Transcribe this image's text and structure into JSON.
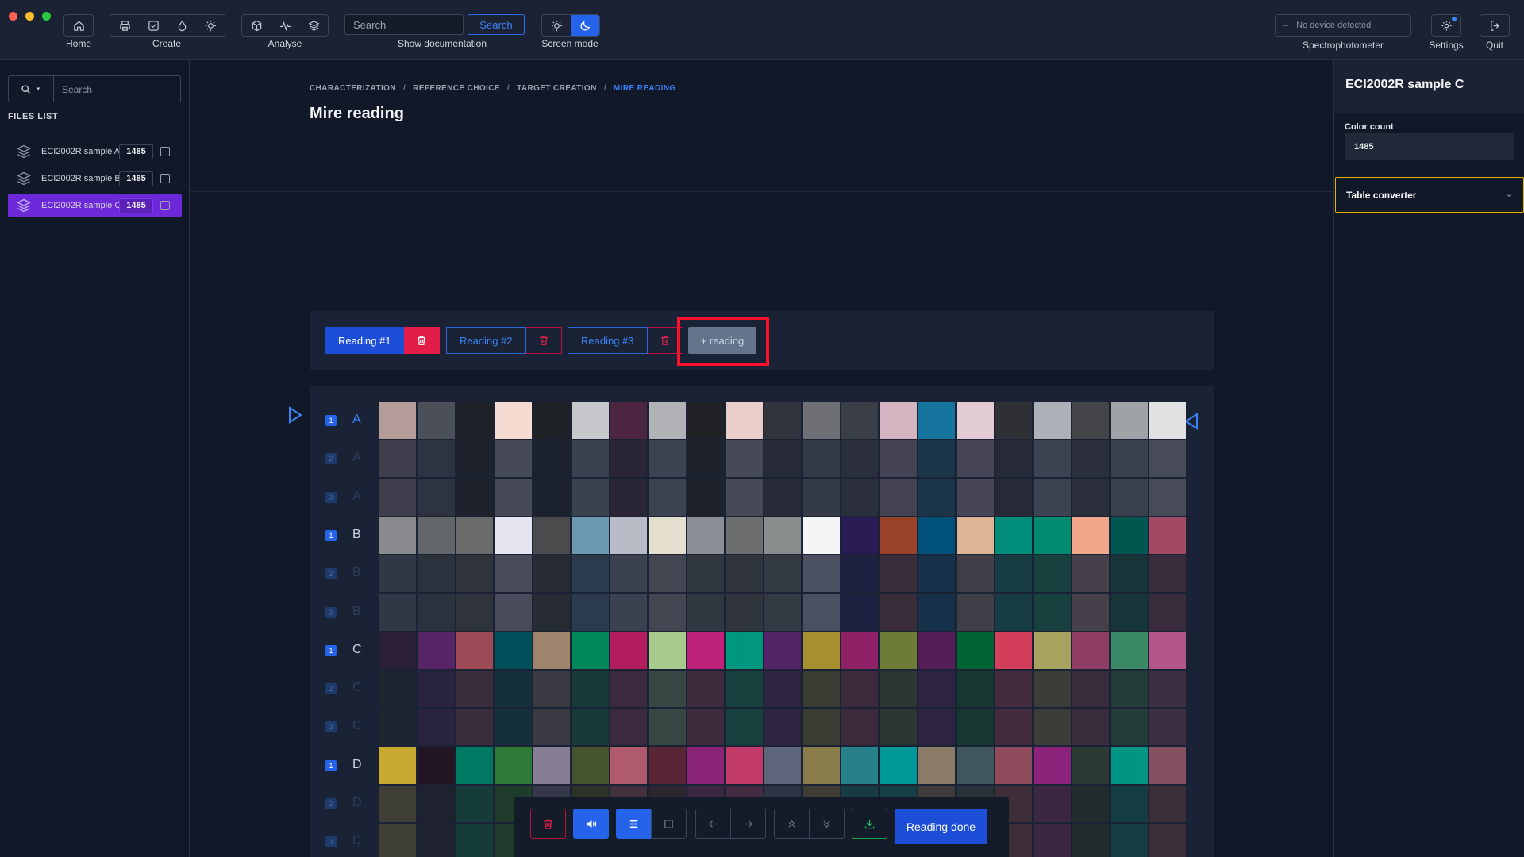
{
  "window_controls": [
    {
      "name": "close",
      "color": "#ff5f57"
    },
    {
      "name": "minimize",
      "color": "#febc2e"
    },
    {
      "name": "maximize",
      "color": "#28c840"
    }
  ],
  "toolbar": {
    "home_label": "Home",
    "create_label": "Create",
    "analyse_label": "Analyse",
    "search_placeholder": "Search",
    "search_button": "Search",
    "show_doc_label": "Show documentation",
    "screen_mode_label": "Screen mode",
    "device_status": "No device detected",
    "spectro_label": "Spectrophotometer",
    "settings_label": "Settings",
    "quit_label": "Quit"
  },
  "sidebar": {
    "search_placeholder": "Search",
    "files_list_title": "FILES LIST",
    "files": [
      {
        "name": "ECI2002R sample A",
        "count": "1485"
      },
      {
        "name": "ECI2002R sample B",
        "count": "1485"
      },
      {
        "name": "ECI2002R sample C",
        "count": "1485"
      }
    ]
  },
  "breadcrumb": [
    "CHARACTERIZATION",
    "REFERENCE CHOICE",
    "TARGET CREATION",
    "MIRE READING"
  ],
  "page_title": "Mire reading",
  "readings": {
    "tabs": [
      "Reading #1",
      "Reading #2",
      "Reading #3"
    ],
    "add_label": "+ reading"
  },
  "grid": {
    "rows": [
      {
        "letter": "A",
        "passes": [
          "1",
          "2",
          "3"
        ]
      },
      {
        "letter": "B",
        "passes": [
          "1",
          "2",
          "3"
        ]
      },
      {
        "letter": "C",
        "passes": [
          "1",
          "2",
          "3"
        ]
      },
      {
        "letter": "D",
        "passes": [
          "1",
          "2",
          "3"
        ]
      }
    ],
    "colors": {
      "A1": [
        "#b49c98",
        "#4a4f58",
        "#1e2127",
        "#f6dbd3",
        "#1e2226",
        "#c6c8cc",
        "#4c2541",
        "#b1b2b6",
        "#202226",
        "#e8cdc9",
        "#31343c",
        "#6f7075",
        "#3a3e47",
        "#d5b4c1",
        "#16759e",
        "#e2cbd4",
        "#2f3035",
        "#aeb0b8",
        "#434549",
        "#9fa3a8",
        "#e1e1e3"
      ],
      "A2": [
        "#3f3f4d",
        "#2d3341",
        "#1d222d",
        "#464a57",
        "#1c222d",
        "#3b424f",
        "#2a2535",
        "#3d4350",
        "#1d222d",
        "#474a56",
        "#262b37",
        "#353a47",
        "#2a2f3b",
        "#444354",
        "#1c3447",
        "#474656",
        "#252a36",
        "#3d4351",
        "#2a2f3b",
        "#3b404d",
        "#474b57"
      ],
      "A3": [
        "#3f3f4d",
        "#2d3341",
        "#1d222d",
        "#464a57",
        "#1c222d",
        "#3b424f",
        "#2a2535",
        "#3d4350",
        "#1d222d",
        "#474a56",
        "#262b37",
        "#353a47",
        "#2a2f3b",
        "#444354",
        "#1c3447",
        "#474656",
        "#252a36",
        "#3d4351",
        "#2a2f3b",
        "#3b404d",
        "#474b57"
      ],
      "B1": [
        "#898a8d",
        "#626668",
        "#6b6b6b",
        "#e6e6f0",
        "#4b4b4d",
        "#6b9ab0",
        "#b9bcc6",
        "#e3dece",
        "#8b8e94",
        "#6c6e70",
        "#8a8d8e",
        "#f4f5f7",
        "#2a1d55",
        "#9a4229",
        "#01527a",
        "#dcb595",
        "#008d79",
        "#008b6e",
        "#f4a68a",
        "#00574f",
        "#a24a63"
      ],
      "B2": [
        "#313845",
        "#2c323d",
        "#2f343c",
        "#4a4b5a",
        "#262a32",
        "#2c3a4e",
        "#3b414e",
        "#434650",
        "#313741",
        "#2f343d",
        "#333a44",
        "#4a5060",
        "#1e2240",
        "#382d38",
        "#17304a",
        "#403f47",
        "#173c44",
        "#17403f",
        "#45404a",
        "#173439",
        "#382c3d"
      ],
      "B3": [
        "#313845",
        "#2c323d",
        "#2f343c",
        "#4a4b5a",
        "#262a32",
        "#2c3a4e",
        "#3b414e",
        "#434650",
        "#313741",
        "#2f343d",
        "#333a44",
        "#4a5060",
        "#1e2240",
        "#382d38",
        "#17304a",
        "#403f47",
        "#173c44",
        "#17403f",
        "#45404a",
        "#173439",
        "#382c3d"
      ],
      "C1": [
        "#2b1f3a",
        "#572466",
        "#9b4a56",
        "#004f5d",
        "#9c846d",
        "#00885a",
        "#b31c5d",
        "#a6cb8d",
        "#be2178",
        "#00977f",
        "#532367",
        "#a58f2e",
        "#8e2066",
        "#6d7c36",
        "#541d56",
        "#006333",
        "#d33e5b",
        "#a6a25f",
        "#8f3d64",
        "#3a8a68",
        "#b2568a"
      ],
      "C2": [
        "#1f2431",
        "#2a2340",
        "#3a2c3b",
        "#162f3c",
        "#3b3a42",
        "#173a38",
        "#3b2a3d",
        "#384644",
        "#3d2a3d",
        "#16403e",
        "#2e2540",
        "#3b3c33",
        "#3a2a3c",
        "#2c3532",
        "#2c2440",
        "#173630",
        "#432c3e",
        "#3b3d38",
        "#3a2b3c",
        "#233d38",
        "#3d2e42"
      ],
      "C3": [
        "#1f2431",
        "#2a2340",
        "#3a2c3b",
        "#162f3c",
        "#3b3a42",
        "#173a38",
        "#3b2a3d",
        "#384644",
        "#3d2a3d",
        "#16403e",
        "#2e2540",
        "#3b3c33",
        "#3a2a3c",
        "#2c3532",
        "#2c2440",
        "#173630",
        "#432c3e",
        "#3b3d38",
        "#3a2b3c",
        "#233d38",
        "#3d2e42"
      ],
      "D1": [
        "#c9a82f",
        "#211622",
        "#007962",
        "#307a37",
        "#867f94",
        "#45542d",
        "#b05a6e",
        "#5a2635",
        "#8a2476",
        "#c23a67",
        "#5c6579",
        "#8b7c4c",
        "#27808a",
        "#009999",
        "#8c7b67",
        "#40575e",
        "#8e4c5c",
        "#8b237a",
        "#2b3a32",
        "#009683",
        "#85505f"
      ],
      "D2": [
        "#3f3f35",
        "#1f2330",
        "#163c3a",
        "#1e3b2c",
        "#37374a",
        "#2c3326",
        "#42323f",
        "#2d2530",
        "#3a2840",
        "#432c3f",
        "#2e3444",
        "#3e3c35",
        "#183c44",
        "#163e46",
        "#3e3b3a",
        "#273238",
        "#3e2e3a",
        "#3c2742",
        "#222c2c",
        "#163e42",
        "#3a2e38"
      ],
      "D3": [
        "#3f3f35",
        "#1f2330",
        "#163c3a",
        "#1e3b2c",
        "#37374a",
        "#2c3326",
        "#42323f",
        "#2d2530",
        "#3a2840",
        "#432c3f",
        "#2e3444",
        "#3e3c35",
        "#183c44",
        "#163e46",
        "#3e3b3a",
        "#273238",
        "#3e2e3a",
        "#3c2742",
        "#222c2c",
        "#163e42",
        "#3a2e38"
      ]
    }
  },
  "bottom_toolbar": {
    "done_label": "Reading done",
    "icons": [
      "trash-icon",
      "sound-icon",
      "list-icon",
      "square-icon",
      "arrow-left-icon",
      "arrow-right-icon",
      "chevrons-up-icon",
      "chevrons-down-icon",
      "download-icon"
    ]
  },
  "right_panel": {
    "title": "ECI2002R sample C",
    "color_count_label": "Color count",
    "color_count_value": "1485",
    "table_converter_label": "Table converter"
  },
  "colors": {
    "accent": "#2563eb",
    "selected_file": "#6d28d9",
    "danger": "#e11d48",
    "highlight": "#ff0f2a"
  }
}
